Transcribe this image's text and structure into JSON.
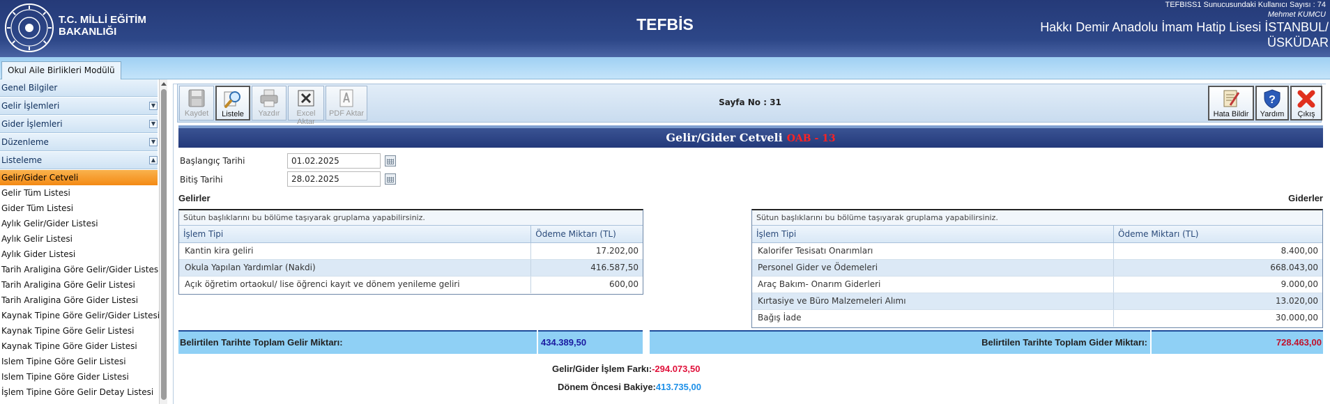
{
  "header": {
    "ministry_line1": "T.C. MİLLİ EĞİTİM",
    "ministry_line2": "BAKANLIĞI",
    "app_title": "TEFBİS",
    "server_info": "TEFBISS1 Sunucusundaki Kullanıcı Sayısı : 74",
    "user_name": "Mehmet KUMCU",
    "school_line1": "Hakkı Demir Anadolu İmam Hatip Lisesi İSTANBUL/",
    "school_line2": "ÜSKÜDAR"
  },
  "module_tab": "Okul Aile Birlikleri Modülü",
  "sidebar": {
    "groups": [
      {
        "label": "Genel Bilgiler",
        "arrow": ""
      },
      {
        "label": "Gelir İşlemleri",
        "arrow": "▼"
      },
      {
        "label": "Gider İşlemleri",
        "arrow": "▼"
      },
      {
        "label": "Düzenleme",
        "arrow": "▼"
      },
      {
        "label": "Listeleme",
        "arrow": "▲"
      }
    ],
    "items": [
      "Gelir/Gider Cetveli",
      "Gelir Tüm Listesi",
      "Gider Tüm Listesi",
      "Aylık Gelir/Gider Listesi",
      "Aylık Gelir Listesi",
      "Aylık Gider Listesi",
      "Tarih Araligina Göre Gelir/Gider Listesi",
      "Tarih Araligina Göre Gelir Listesi",
      "Tarih Araligina Göre Gider Listesi",
      "Kaynak Tipine Göre Gelir/Gider Listesi",
      "Kaynak Tipine Göre Gelir Listesi",
      "Kaynak Tipine Göre Gider Listesi",
      "Islem Tipine Göre Gelir Listesi",
      "Islem Tipine Göre Gider Listesi",
      "İşlem Tipine Göre Gelir Detay Listesi"
    ],
    "active_item": "Gelir/Gider Cetveli"
  },
  "toolbar": {
    "kaydet": "Kaydet",
    "listele": "Listele",
    "yazdir": "Yazdır",
    "excel": "Excel Aktar",
    "pdf": "PDF Aktar",
    "page_no": "Sayfa No : 31",
    "hata": "Hata Bildir",
    "yardim": "Yardım",
    "cikis": "Çıkış"
  },
  "form": {
    "title": "Gelir/Gider Cetveli",
    "title_code": "OAB - 13",
    "start_label": "Başlangıç Tarihi",
    "start_value": "01.02.2025",
    "end_label": "Bitiş Tarihi",
    "end_value": "28.02.2025"
  },
  "gelirler": {
    "title": "Gelirler",
    "group_hint": "Sütun başlıklarını bu bölüme taşıyarak gruplama yapabilirsiniz.",
    "col1": "İşlem Tipi",
    "col2": "Ödeme Miktarı (TL)",
    "rows": [
      {
        "tip": "Kantin kira geliri",
        "miktar": "17.202,00"
      },
      {
        "tip": "Okula Yapılan Yardımlar (Nakdi)",
        "miktar": "416.587,50"
      },
      {
        "tip": "Açık öğretim ortaokul/ lise öğrenci kayıt ve dönem yenileme geliri",
        "miktar": "600,00"
      }
    ],
    "total_label": "Belirtilen Tarihte Toplam Gelir Miktarı:",
    "total_value": "434.389,50"
  },
  "giderler": {
    "title": "Giderler",
    "group_hint": "Sütun başlıklarını bu bölüme taşıyarak gruplama yapabilirsiniz.",
    "col1": "İşlem Tipi",
    "col2": "Ödeme Miktarı (TL)",
    "rows": [
      {
        "tip": "Kalorifer Tesisatı Onarımları",
        "miktar": "8.400,00"
      },
      {
        "tip": "Personel Gider ve Ödemeleri",
        "miktar": "668.043,00"
      },
      {
        "tip": "Araç Bakım- Onarım Giderleri",
        "miktar": "9.000,00"
      },
      {
        "tip": "Kırtasiye ve Büro Malzemeleri Alımı",
        "miktar": "13.020,00"
      },
      {
        "tip": "Bağış İade",
        "miktar": "30.000,00"
      }
    ],
    "total_label": "Belirtilen Tarihte Toplam Gider Miktarı:",
    "total_value": "728.463,00"
  },
  "summary": {
    "fark_label": "Gelir/Gider İşlem Farkı:",
    "fark_value": "-294.073,50",
    "bakiye_label": "Dönem Öncesi Bakiye:",
    "bakiye_value": "413.735,00"
  },
  "colors": {
    "header_bg": "#253a78",
    "active_menu": "#f48a14",
    "title_code": "#ff2222",
    "gelir_total": "#1a1aa0",
    "gider_total": "#c0102a",
    "fark": "#e0103a",
    "bakiye": "#1e90e8"
  }
}
